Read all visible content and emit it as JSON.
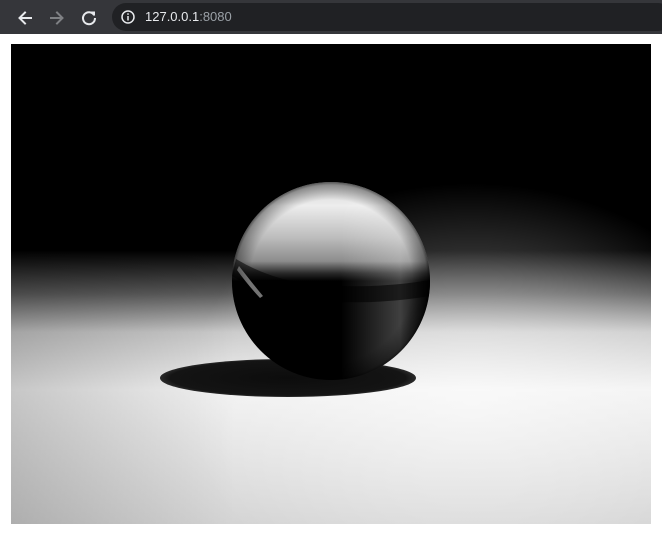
{
  "browser": {
    "url_host": "127.0.0.1",
    "url_port": ":8080",
    "icons": {
      "back": "back-arrow-icon",
      "forward": "forward-arrow-icon",
      "reload": "reload-icon",
      "site_info": "info-icon"
    },
    "colors": {
      "toolbar": "#35363a",
      "omnibox": "#202124",
      "url_host": "#e8eaed",
      "url_port": "#9aa0a6",
      "forward_disabled": "#7f8184"
    }
  },
  "page": {
    "scene": {
      "objects": [
        "sphere",
        "ground-plane",
        "shadow"
      ],
      "colors": {
        "sky": "#000000",
        "floor_light": "#f2f2f2",
        "floor_mid": "#d6d6d6",
        "shadow": "#151515",
        "sphere_dark": "#000000",
        "sphere_highlight": "#ececec"
      }
    }
  }
}
